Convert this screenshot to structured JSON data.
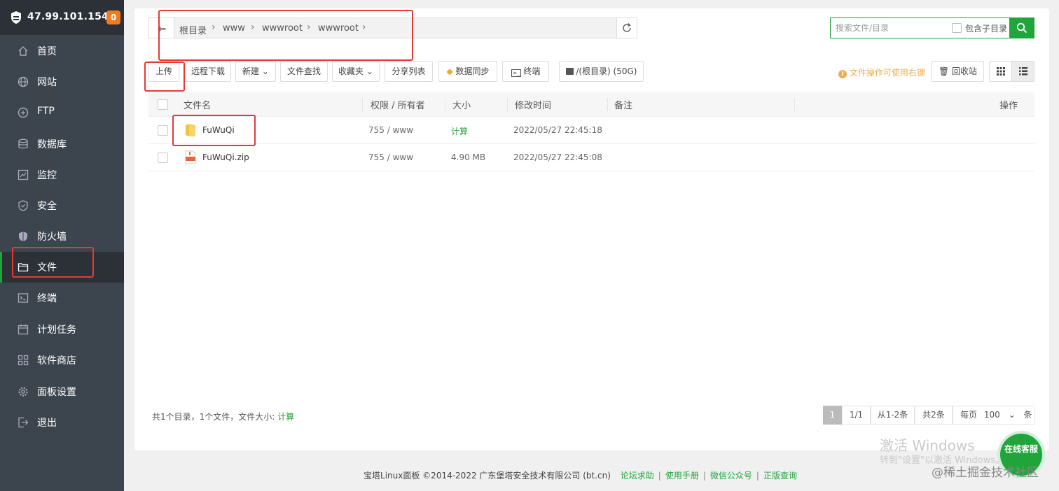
{
  "sidebar": {
    "ip": "47.99.101.154",
    "badge": "0",
    "items": [
      {
        "label": "首页"
      },
      {
        "label": "网站"
      },
      {
        "label": "FTP"
      },
      {
        "label": "数据库"
      },
      {
        "label": "监控"
      },
      {
        "label": "安全"
      },
      {
        "label": "防火墙"
      },
      {
        "label": "文件"
      },
      {
        "label": "终端"
      },
      {
        "label": "计划任务"
      },
      {
        "label": "软件商店"
      },
      {
        "label": "面板设置"
      },
      {
        "label": "退出"
      }
    ],
    "active": "文件"
  },
  "breadcrumb": [
    "根目录",
    "www",
    "wwwroot",
    "wwwroot"
  ],
  "search": {
    "placeholder": "搜索文件/目录",
    "include_sub": "包含子目录"
  },
  "toolbar": {
    "upload": "上传",
    "remote_download": "远程下载",
    "new": "新建",
    "find": "文件查找",
    "favorites": "收藏夹",
    "share_list": "分享列表",
    "data_sync": "数据同步",
    "terminal": "终端",
    "disk": "/(根目录) (50G)",
    "tip": "文件操作可使用右键",
    "recycle": "回收站"
  },
  "table": {
    "headers": {
      "name": "文件名",
      "perm": "权限 / 所有者",
      "size": "大小",
      "mtime": "修改时间",
      "note": "备注",
      "ops": "操作"
    },
    "rows": [
      {
        "name": "FuWuQi",
        "perm": "755 / www",
        "size": "计算",
        "mtime": "2022/05/27 22:45:18"
      },
      {
        "name": "FuWuQi.zip",
        "perm": "755 / www",
        "size": "4.90 MB",
        "mtime": "2022/05/27 22:45:08"
      }
    ]
  },
  "summary": {
    "text": "共1个目录，1个文件，文件大小:",
    "calc": "计算"
  },
  "pagination": {
    "current": "1",
    "pages": "1/1",
    "range": "从1-2条",
    "total": "共2条",
    "per_page_label": "每页",
    "per_page": "100",
    "unit": "条"
  },
  "footer": {
    "copyright": "宝塔Linux面板 ©2014-2022 广东堡塔安全技术有限公司 (bt.cn)",
    "links": [
      "论坛求助",
      "使用手册",
      "微信公众号",
      "正版查询"
    ]
  },
  "overlay": {
    "activate_title": "激活 Windows",
    "activate_sub": "转到\"设置\"以激活 Windows。",
    "service": "在线客服",
    "watermark": "@稀土掘金技术社区"
  },
  "colors": {
    "accent": "#20a53a",
    "sidebar": "#3c444d",
    "sidebar_dark": "#2b3137",
    "badge": "#f37b1d",
    "highlight": "#e53935"
  }
}
